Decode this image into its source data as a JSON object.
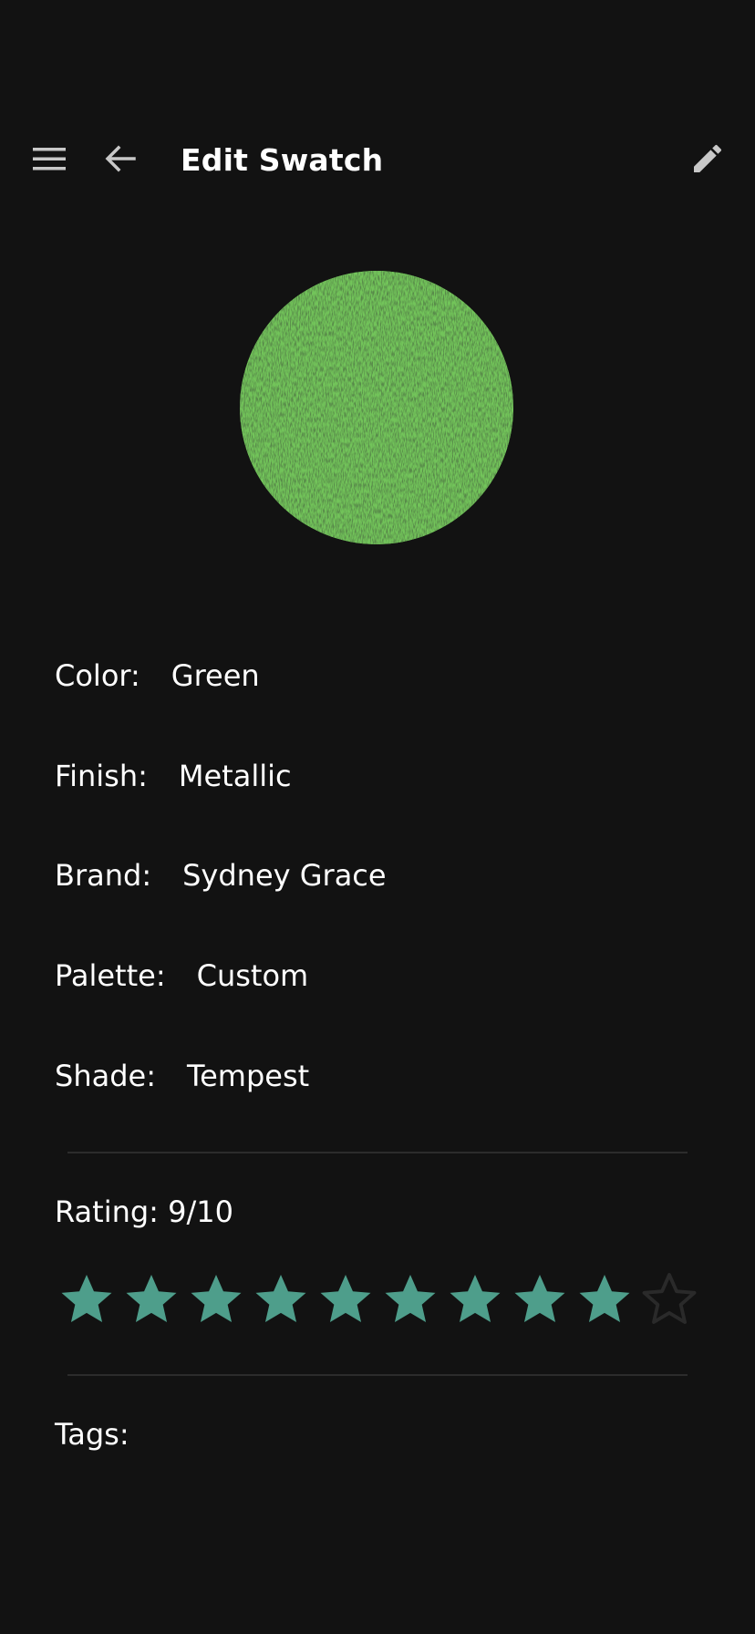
{
  "header": {
    "title": "Edit Swatch",
    "menu_icon": "hamburger-menu-icon",
    "back_icon": "arrow-left-icon",
    "edit_icon": "pencil-icon"
  },
  "swatch": {
    "color_hex": "#72c45a",
    "texture": "metallic-speckle"
  },
  "details": {
    "color_label": "Color:",
    "color_value": "Green",
    "finish_label": "Finish:",
    "finish_value": "Metallic",
    "brand_label": "Brand:",
    "brand_value": "Sydney Grace",
    "palette_label": "Palette:",
    "palette_value": "Custom",
    "shade_label": "Shade:",
    "shade_value": "Tempest"
  },
  "rating": {
    "label": "Rating: 9/10",
    "value": 9,
    "max": 10,
    "filled_color": "#4e9e8b",
    "empty_color": "#2a2a2a"
  },
  "tags": {
    "label": "Tags:"
  },
  "colors": {
    "background": "#121212",
    "text": "#ffffff",
    "icon": "#c8c8c8",
    "divider": "#2c2c2c"
  }
}
